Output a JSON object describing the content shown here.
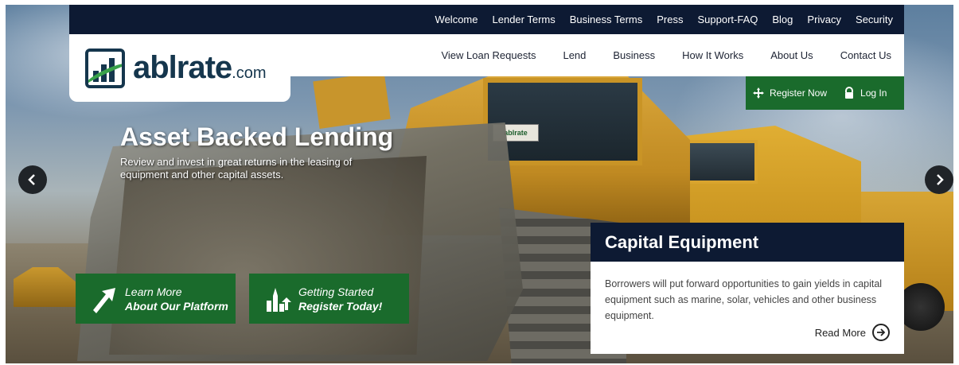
{
  "topnav": {
    "items": [
      "Welcome",
      "Lender Terms",
      "Business Terms",
      "Press",
      "Support-FAQ",
      "Blog",
      "Privacy",
      "Security"
    ]
  },
  "mainnav": {
    "items": [
      "View Loan Requests",
      "Lend",
      "Business",
      "How It Works",
      "About Us",
      "Contact Us"
    ]
  },
  "logo": {
    "name": "ablrate",
    "suffix": ".com"
  },
  "auth": {
    "register_label": "Register Now",
    "register_icon": "move-arrows-icon",
    "login_label": "Log In",
    "login_icon": "lock-icon"
  },
  "hero": {
    "title": "Asset Backed Lending",
    "subtitle": "Review and invest in great returns in the leasing of equipment and other capital assets.",
    "decal": "ablrate"
  },
  "carousel": {
    "prev_icon": "chevron-left-icon",
    "next_icon": "chevron-right-icon"
  },
  "cta": {
    "learn": {
      "line1": "Learn More",
      "line2": "About Our Platform",
      "icon": "arrow-up-right-icon"
    },
    "start": {
      "line1": "Getting Started",
      "line2": "Register Today!",
      "icon": "growth-icon"
    }
  },
  "card": {
    "title": "Capital Equipment",
    "text": "Borrowers will put forward opportunities to gain yields in capital equipment such as marine, solar, vehicles and other business equipment.",
    "read_more": "Read More",
    "read_more_icon": "arrow-circle-right-icon"
  },
  "colors": {
    "navy": "#0d1a33",
    "green": "#1a6b2c",
    "logo_blue": "#15364d",
    "logo_green": "#3aa24a"
  }
}
